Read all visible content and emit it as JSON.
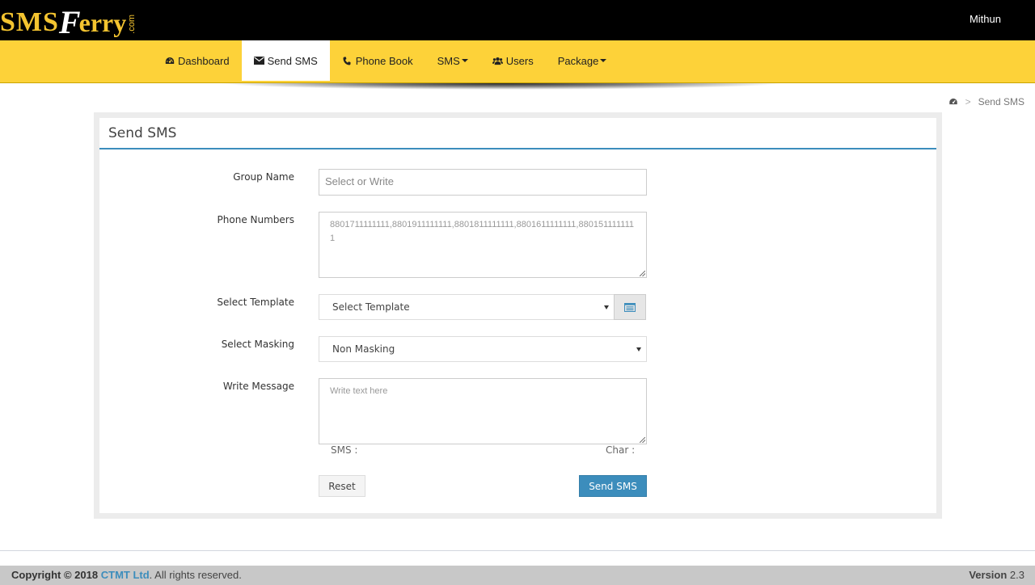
{
  "brand": {
    "logo_sms": "SMS",
    "logo_f": "F",
    "logo_erry": "erry",
    "logo_com": ".com",
    "accent_color": "#fdd239",
    "primary_color": "#3c8dbc"
  },
  "header": {
    "user_name": "Mithun"
  },
  "nav": {
    "items": [
      {
        "label": "Dashboard",
        "icon": "dashboard-icon",
        "active": false,
        "dropdown": false
      },
      {
        "label": "Send SMS",
        "icon": "envelope-icon",
        "active": true,
        "dropdown": false
      },
      {
        "label": "Phone Book",
        "icon": "phone-icon",
        "active": false,
        "dropdown": false
      },
      {
        "label": "SMS",
        "icon": "",
        "active": false,
        "dropdown": true
      },
      {
        "label": "Users",
        "icon": "users-icon",
        "active": false,
        "dropdown": false
      },
      {
        "label": "Package",
        "icon": "",
        "active": false,
        "dropdown": true
      }
    ]
  },
  "breadcrumb": {
    "separator": ">",
    "current": "Send SMS",
    "home_icon": "dashboard-icon"
  },
  "form": {
    "title": "Send SMS",
    "group_name": {
      "label": "Group Name",
      "placeholder": "Select or Write"
    },
    "phone_numbers": {
      "label": "Phone Numbers",
      "placeholder": "8801711111111,8801911111111,8801811111111,8801611111111,8801511111111"
    },
    "template": {
      "label": "Select Template",
      "selected": "Select Template",
      "button_icon": "list-icon"
    },
    "masking": {
      "label": "Select Masking",
      "selected": "Non Masking"
    },
    "message": {
      "label": "Write Message",
      "placeholder": "Write text here"
    },
    "sms_counter": "SMS :",
    "char_counter": "Char :",
    "reset_label": "Reset",
    "send_label": "Send SMS"
  },
  "footer": {
    "copyright_prefix": "Copyright © 2018",
    "company": "CTMT Ltd",
    "rights": ". All rights reserved.",
    "version_label": "Version",
    "version_value": "2.3"
  }
}
